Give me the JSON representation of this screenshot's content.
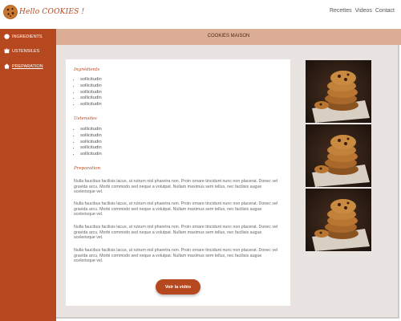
{
  "header": {
    "brand": "Hello COOKIES !",
    "nav": [
      "Recettes",
      "Videos",
      "Contact"
    ]
  },
  "sidebar": {
    "items": [
      {
        "label": "INGREDIENTS",
        "icon": "circle-icon"
      },
      {
        "label": "USTENSILES",
        "icon": "pot-icon"
      },
      {
        "label": "PREPARATION",
        "icon": "home-icon"
      }
    ]
  },
  "banner": {
    "title": "COOKIES MAISON"
  },
  "card": {
    "ingredients_title": "Ingrédients",
    "ingredients": [
      "sollicitudin",
      "sollicitudin",
      "sollicitudin",
      "sollicitudin",
      "sollicitudin"
    ],
    "ustensiles_title": "Ustensiles",
    "ustensiles": [
      "sollicitudin",
      "sollicitudin",
      "sollicitudin",
      "sollicitudin",
      "sollicitudin"
    ],
    "preparation_title": "Preparation",
    "paragraphs": [
      "Nulla faucibus facilisis lacus, ut rutrum nisl pharetra non. Proin ornare tincidunt nunc non placerat. Donec vel gravida arcu. Morbi commodo sed neque a volutpat. Nullam maximus sem tellus, nec facilisis augue scelerisque vel.",
      "Nulla faucibus facilisis lacus, ut rutrum nisl pharetra non. Proin ornare tincidunt nunc non placerat. Donec vel gravida arcu. Morbi commodo sed neque a volutpat. Nullam maximus sem tellus, nec facilisis augue scelerisque vel.",
      "Nulla faucibus facilisis lacus, ut rutrum nisl pharetra non. Proin ornare tincidunt nunc non placerat. Donec vel gravida arcu. Morbi commodo sed neque a volutpat. Nullam maximus sem tellus, nec facilisis augue scelerisque vel.",
      "Nulla faucibus facilisis lacus, ut rutrum nisl pharetra non. Proin ornare tincidunt nunc non placerat. Donec vel gravida arcu. Morbi commodo sed neque a volutpat. Nullam maximus sem tellus, nec facilisis augue scelerisque vel."
    ],
    "video_button": "Voir la vidéo"
  },
  "colors": {
    "accent": "#b5481f",
    "banner": "#dcae95",
    "background": "#e9e4e1"
  }
}
